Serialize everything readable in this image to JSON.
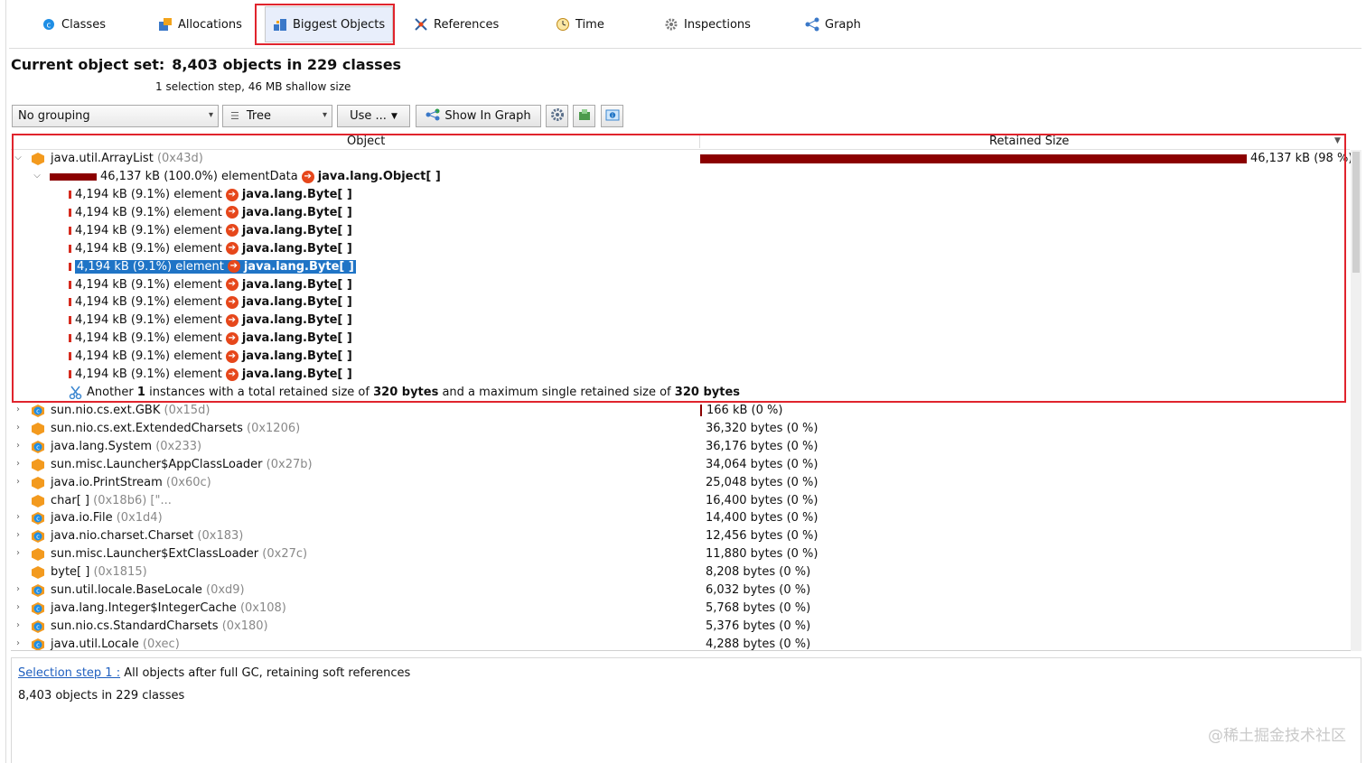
{
  "tabs": [
    {
      "label": "Classes",
      "icon": "classes-icon"
    },
    {
      "label": "Allocations",
      "icon": "allocations-icon"
    },
    {
      "label": "Biggest Objects",
      "icon": "biggest-objects-icon"
    },
    {
      "label": "References",
      "icon": "references-icon"
    },
    {
      "label": "Time",
      "icon": "time-icon"
    },
    {
      "label": "Inspections",
      "icon": "inspections-icon"
    },
    {
      "label": "Graph",
      "icon": "graph-icon"
    }
  ],
  "header": {
    "label": "Current object set:",
    "value": "8,403 objects in 229 classes",
    "subtitle": "1 selection step, 46 MB shallow size"
  },
  "toolbar": {
    "grouping": "No grouping",
    "view": "Tree",
    "use": "Use ...",
    "show_in_graph": "Show In Graph"
  },
  "table": {
    "columns": [
      "Object",
      "Retained Size"
    ],
    "root": {
      "name": "java.util.ArrayList",
      "addr": "(0x43d)",
      "size": "46,137 kB (98 %)",
      "fraction": 0.98
    },
    "field": {
      "size": "46,137 kB (100.0%) elementData",
      "type": "java.lang.Object[ ]"
    },
    "elements": [
      {
        "text": "4,194 kB (9.1%) element",
        "type": "java.lang.Byte[ ]"
      },
      {
        "text": "4,194 kB (9.1%) element",
        "type": "java.lang.Byte[ ]"
      },
      {
        "text": "4,194 kB (9.1%) element",
        "type": "java.lang.Byte[ ]"
      },
      {
        "text": "4,194 kB (9.1%) element",
        "type": "java.lang.Byte[ ]"
      },
      {
        "text": "4,194 kB (9.1%) element",
        "type": "java.lang.Byte[ ]"
      },
      {
        "text": "4,194 kB (9.1%) element",
        "type": "java.lang.Byte[ ]"
      },
      {
        "text": "4,194 kB (9.1%) element",
        "type": "java.lang.Byte[ ]"
      },
      {
        "text": "4,194 kB (9.1%) element",
        "type": "java.lang.Byte[ ]"
      },
      {
        "text": "4,194 kB (9.1%) element",
        "type": "java.lang.Byte[ ]"
      },
      {
        "text": "4,194 kB (9.1%) element",
        "type": "java.lang.Byte[ ]"
      },
      {
        "text": "4,194 kB (9.1%) element",
        "type": "java.lang.Byte[ ]"
      }
    ],
    "another": {
      "a": "Another",
      "b": "1",
      "c": "instances with a total retained size of",
      "d": "320 bytes",
      "e": "and a maximum single retained size of",
      "f": "320 bytes"
    },
    "rows": [
      {
        "name": "sun.nio.cs.ext.GBK",
        "addr": "(0x15d)",
        "size": "166 kB (0 %)",
        "kind": "class",
        "expand": true
      },
      {
        "name": "sun.nio.cs.ext.ExtendedCharsets",
        "addr": "(0x1206)",
        "size": "36,320 bytes (0 %)",
        "kind": "object",
        "expand": true
      },
      {
        "name": "java.lang.System",
        "addr": "(0x233)",
        "size": "36,176 bytes (0 %)",
        "kind": "class",
        "expand": true
      },
      {
        "name": "sun.misc.Launcher$AppClassLoader",
        "addr": "(0x27b)",
        "size": "34,064 bytes (0 %)",
        "kind": "object",
        "expand": true
      },
      {
        "name": "java.io.PrintStream",
        "addr": "(0x60c)",
        "size": "25,048 bytes (0 %)",
        "kind": "object",
        "expand": true
      },
      {
        "name": "char[ ]",
        "addr": "(0x18b6) [\"...",
        "size": "16,400 bytes (0 %)",
        "kind": "object",
        "expand": false
      },
      {
        "name": "java.io.File",
        "addr": "(0x1d4)",
        "size": "14,400 bytes (0 %)",
        "kind": "class",
        "expand": true
      },
      {
        "name": "java.nio.charset.Charset",
        "addr": "(0x183)",
        "size": "12,456 bytes (0 %)",
        "kind": "class",
        "expand": true
      },
      {
        "name": "sun.misc.Launcher$ExtClassLoader",
        "addr": "(0x27c)",
        "size": "11,880 bytes (0 %)",
        "kind": "object",
        "expand": true
      },
      {
        "name": "byte[ ]",
        "addr": "(0x1815)",
        "size": "8,208 bytes (0 %)",
        "kind": "object",
        "expand": false
      },
      {
        "name": "sun.util.locale.BaseLocale",
        "addr": "(0xd9)",
        "size": "6,032 bytes (0 %)",
        "kind": "class",
        "expand": true
      },
      {
        "name": "java.lang.Integer$IntegerCache",
        "addr": "(0x108)",
        "size": "5,768 bytes (0 %)",
        "kind": "class",
        "expand": true
      },
      {
        "name": "sun.nio.cs.StandardCharsets",
        "addr": "(0x180)",
        "size": "5,376 bytes (0 %)",
        "kind": "class",
        "expand": true
      },
      {
        "name": "java.util.Locale",
        "addr": "(0xec)",
        "size": "4,288 bytes (0 %)",
        "kind": "class",
        "expand": true
      }
    ]
  },
  "footer": {
    "step_link": "Selection step 1 :",
    "step_desc": "All objects after full GC, retaining soft references",
    "summary": "8,403 objects in 229 classes"
  },
  "watermark": "@稀土掘金技术社区",
  "colors": {
    "accent": "#1f74c6",
    "bar": "#8b0000",
    "highlight": "#e0242d"
  }
}
